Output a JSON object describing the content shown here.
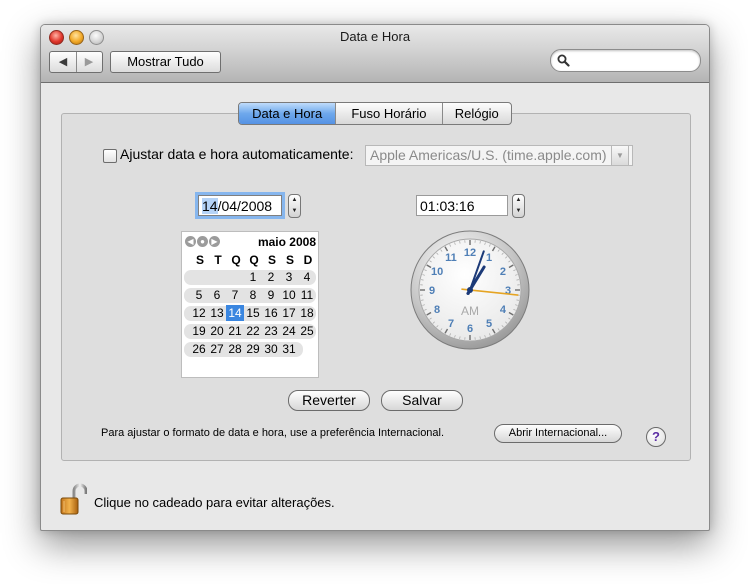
{
  "window": {
    "title": "Data e Hora"
  },
  "toolbar": {
    "back_glyph": "◀",
    "forward_glyph": "▶",
    "show_all_label": "Mostrar Tudo",
    "search_icon": "magnifier-icon",
    "search_value": "",
    "search_placeholder": ""
  },
  "tabs": [
    {
      "label": "Data e Hora",
      "selected": true
    },
    {
      "label": "Fuso Horário",
      "selected": false
    },
    {
      "label": "Relógio",
      "selected": false
    }
  ],
  "auto_time": {
    "label": "Ajustar data e hora automaticamente:",
    "checked": false,
    "server": "Apple Americas/U.S. (time.apple.com)",
    "server_enabled": false
  },
  "date": {
    "day": "14",
    "rest": "/04/2008"
  },
  "time": {
    "value": "01:03:16"
  },
  "calendar": {
    "month_label": "maio 2008",
    "weekday_headers": [
      "S",
      "T",
      "Q",
      "Q",
      "S",
      "S",
      "D"
    ],
    "selected_day": "14",
    "weeks": [
      [
        "",
        "",
        "",
        "1",
        "2",
        "3",
        "4"
      ],
      [
        "5",
        "6",
        "7",
        "8",
        "9",
        "10",
        "11"
      ],
      [
        "12",
        "13",
        "14",
        "15",
        "16",
        "17",
        "18"
      ],
      [
        "19",
        "20",
        "21",
        "22",
        "23",
        "24",
        "25"
      ],
      [
        "26",
        "27",
        "28",
        "29",
        "30",
        "31",
        ""
      ]
    ]
  },
  "clock": {
    "hour": 1,
    "minute": 3,
    "second": 16,
    "period_label": "AM",
    "numerals": [
      "12",
      "1",
      "2",
      "3",
      "4",
      "5",
      "6",
      "7",
      "8",
      "9",
      "10",
      "11"
    ],
    "numeral_color": "#4f7fb6",
    "second_hand_color": "#e5a423"
  },
  "buttons": {
    "revert": "Reverter",
    "save": "Salvar",
    "open_international": "Abrir Internacional...",
    "help": "?"
  },
  "hint_text": "Para ajustar o formato de data e hora, use a preferência Internacional.",
  "lock": {
    "icon": "unlocked-padlock-icon",
    "label": "Clique no cadeado para evitar alterações."
  },
  "colors": {
    "selection_blue": "#3a86e0",
    "selected_tab": "#6ea8ec",
    "help_mark": "#5c2ea3"
  }
}
